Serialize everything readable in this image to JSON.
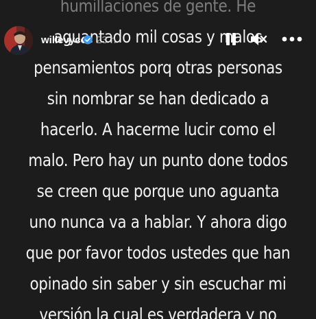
{
  "header": {
    "username": "willevycol",
    "time": "23 h",
    "icons": {
      "avatar": "avatar",
      "verified": "verified-badge-icon",
      "pause": "pause-icon",
      "mute": "mute-icon",
      "more": "more-options-icon"
    }
  },
  "story": {
    "lines": [
      "humillaciones de gente. He",
      "aguantado mil cosas y malos",
      "pensamientos porq otras personas",
      "sin nombrar se han dedicado a",
      "hacerlo. A hacerme lucir como el",
      "malo. Pero hay un punto done todos",
      "se creen que porque uno aguanta",
      "uno nunca va a hablar. Y ahora digo",
      "que por favor todos ustedes que han",
      "opinado sin saber y sin escuchar mi",
      "versión la cual es verdadera y no"
    ]
  },
  "colors": {
    "background": "#1c1c1c",
    "text": "#f2f2f2",
    "verified": "#3897f0"
  }
}
